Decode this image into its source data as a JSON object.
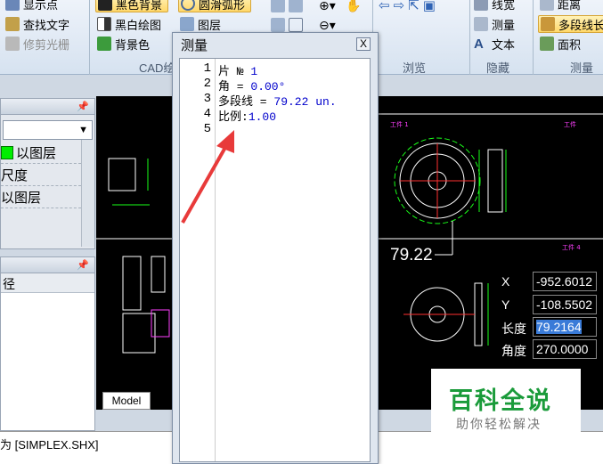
{
  "ribbon": {
    "col1": {
      "show_points": "显示点",
      "find_text": "查找文字",
      "trim_raster": "修剪光栅"
    },
    "col2": {
      "black_bg": "黑色背景",
      "bw_draw": "黑白绘图",
      "bg_color": "背景色"
    },
    "col3": {
      "smooth_arc": "圆滑弧形",
      "layers": "图层"
    },
    "col5": {
      "line_width": "线宽",
      "measure": "测量",
      "text": "文本"
    },
    "col6": {
      "distance": "距离",
      "polyline_length": "多段线长",
      "area": "面积"
    },
    "groups": {
      "cad_draw": "CAD绘",
      "browse": "浏览",
      "hide": "隐藏",
      "measure": "测量"
    }
  },
  "left": {
    "top_rows": [
      "以图层",
      "尺度",
      "以图层"
    ],
    "bottom_row": "径"
  },
  "canvas": {
    "model_tab": "Model",
    "dimension": "79.22",
    "coords": {
      "x_label": "X",
      "x_value": "-952.6012",
      "y_label": "Y",
      "y_value": "-108.5502",
      "len_label": "长度",
      "len_value": "79.2164",
      "angle_label": "角度",
      "angle_value": "270.0000"
    }
  },
  "dialog": {
    "title": "测量",
    "close": "X",
    "lines": [
      {
        "num": "1",
        "label": "片 № ",
        "value": "1"
      },
      {
        "num": "2",
        "label": "角 = ",
        "value": "0.00°"
      },
      {
        "num": "3",
        "label": "多段线 = ",
        "value": "79.22 un."
      },
      {
        "num": "4",
        "label": "比例:",
        "value": "1.00"
      },
      {
        "num": "5",
        "label": "",
        "value": ""
      }
    ]
  },
  "status": {
    "text": "为 [SIMPLEX.SHX]"
  },
  "watermark": {
    "main": "百科全说",
    "sub": "助你轻松解决"
  },
  "colors": {
    "accent": "#e83a3a",
    "cad_bg": "#000000",
    "ribbon_bg": "#dbe5f1"
  }
}
